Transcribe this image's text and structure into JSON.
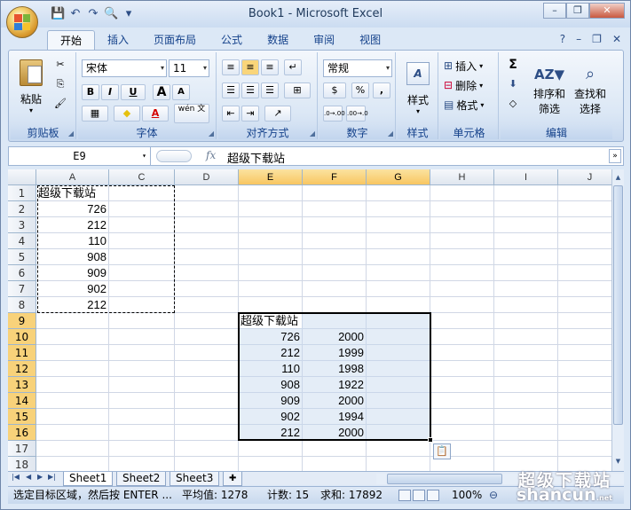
{
  "window": {
    "title": "Book1 - Microsoft Excel",
    "minimize": "–",
    "restore": "❐",
    "close": "✕"
  },
  "qat": {
    "save": "💾",
    "undo": "↶",
    "redo": "↷",
    "preview": "🔍",
    "more": "▾"
  },
  "ribbon_tabs": [
    "开始",
    "插入",
    "页面布局",
    "公式",
    "数据",
    "审阅",
    "视图"
  ],
  "tab_right": {
    "help": "?",
    "min": "–",
    "restore": "❐",
    "close": "✕"
  },
  "groups": {
    "clipboard": {
      "label": "剪贴板",
      "paste": "粘贴",
      "cut": "✂",
      "copy": "⎘",
      "format": "🖌"
    },
    "font": {
      "label": "字体",
      "name": "宋体",
      "size": "11",
      "bold": "B",
      "italic": "I",
      "underline": "U",
      "grow": "A",
      "shrink": "A",
      "border": "▦",
      "fill": "◆",
      "color": "A",
      "phonetic": "wén 文"
    },
    "align": {
      "label": "对齐方式"
    },
    "number": {
      "label": "数字",
      "format": "常规",
      "currency": "$",
      "percent": "%",
      "comma": ",",
      "inc": ".0→.00",
      "dec": ".00→.0"
    },
    "styles": {
      "label": "样式"
    },
    "cells": {
      "label": "单元格",
      "insert": "插入",
      "delete": "删除",
      "format": "格式"
    },
    "editing": {
      "label": "编辑",
      "sum": "Σ",
      "fill": "⬇",
      "clear": "◇",
      "sort": "排序和筛选",
      "find": "查找和选择",
      "sort1": "排序和",
      "sort2": "筛选",
      "find1": "查找和",
      "find2": "选择"
    }
  },
  "formula_bar": {
    "namebox": "E9",
    "fx": "fx",
    "content": "超级下载站"
  },
  "columns": [
    "A",
    "C",
    "D",
    "E",
    "F",
    "G",
    "H",
    "I",
    "J"
  ],
  "rows": [
    "1",
    "2",
    "3",
    "4",
    "5",
    "6",
    "7",
    "8",
    "9",
    "10",
    "11",
    "12",
    "13",
    "14",
    "15",
    "16",
    "17",
    "18"
  ],
  "source": {
    "header": "超级下载站",
    "values": [
      "726",
      "212",
      "110",
      "908",
      "909",
      "902",
      "212"
    ]
  },
  "pasted": {
    "header": "超级下载站",
    "col_e": [
      "726",
      "212",
      "110",
      "908",
      "909",
      "902",
      "212"
    ],
    "col_f": [
      "2000",
      "1999",
      "1998",
      "1922",
      "2000",
      "1994",
      "2000"
    ]
  },
  "sheets": [
    "Sheet1",
    "Sheet2",
    "Sheet3"
  ],
  "status": {
    "message": "选定目标区域，然后按 ENTER ...",
    "average": "平均值: 1278",
    "count": "计数: 15",
    "sum": "求和: 17892",
    "zoom": "100%",
    "zoom_minus": "⊖"
  },
  "watermark": {
    "line1": "超级下载站",
    "line2": "shancun",
    "line3": ".net"
  }
}
